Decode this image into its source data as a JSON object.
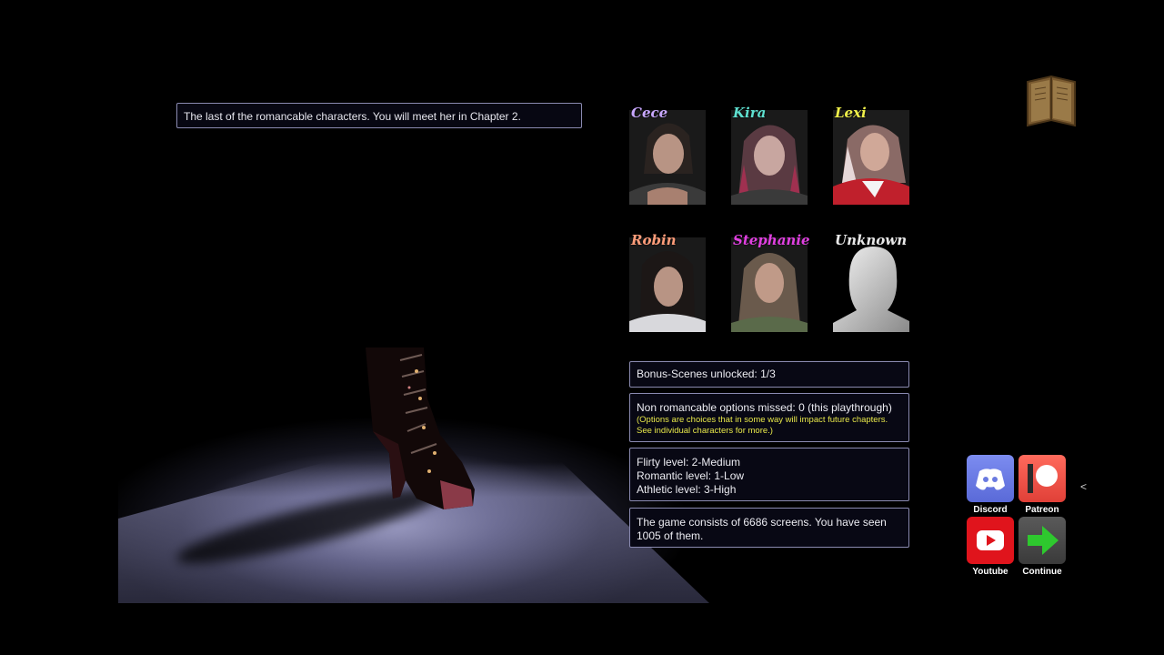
{
  "caption": "The last of the romancable characters. You will meet her in Chapter 2.",
  "characters": [
    {
      "name": "Cece",
      "color": "#c9a8ff"
    },
    {
      "name": "Kira",
      "color": "#5fe0d0"
    },
    {
      "name": "Lexi",
      "color": "#f0f04a"
    },
    {
      "name": "Robin",
      "color": "#ff9d7a"
    },
    {
      "name": "Stephanie",
      "color": "#e040e0"
    },
    {
      "name": "Unknown",
      "color": "#e8e8e8"
    }
  ],
  "stats": {
    "bonus": "Bonus-Scenes unlocked: 1/3",
    "missed": "Non romancable options missed: 0 (this playthrough)",
    "missed_note_1": "(Options are choices that in some way will impact future chapters.",
    "missed_note_2": "See individual characters for more.)",
    "flirty": "Flirty level: 2-Medium",
    "romantic": "Romantic level: 1-Low",
    "athletic": "Athletic level: 3-High",
    "screens_1": "The game consists of 6686 screens. You have seen",
    "screens_2": "1005 of them."
  },
  "social": {
    "discord": "Discord",
    "patreon": "Patreon",
    "youtube": "Youtube",
    "continue": "Continue"
  },
  "chevron": "<",
  "icons": {
    "book": "book-icon",
    "discord": "discord-icon",
    "patreon": "patreon-icon",
    "youtube": "youtube-icon",
    "continue": "arrow-right-icon"
  }
}
